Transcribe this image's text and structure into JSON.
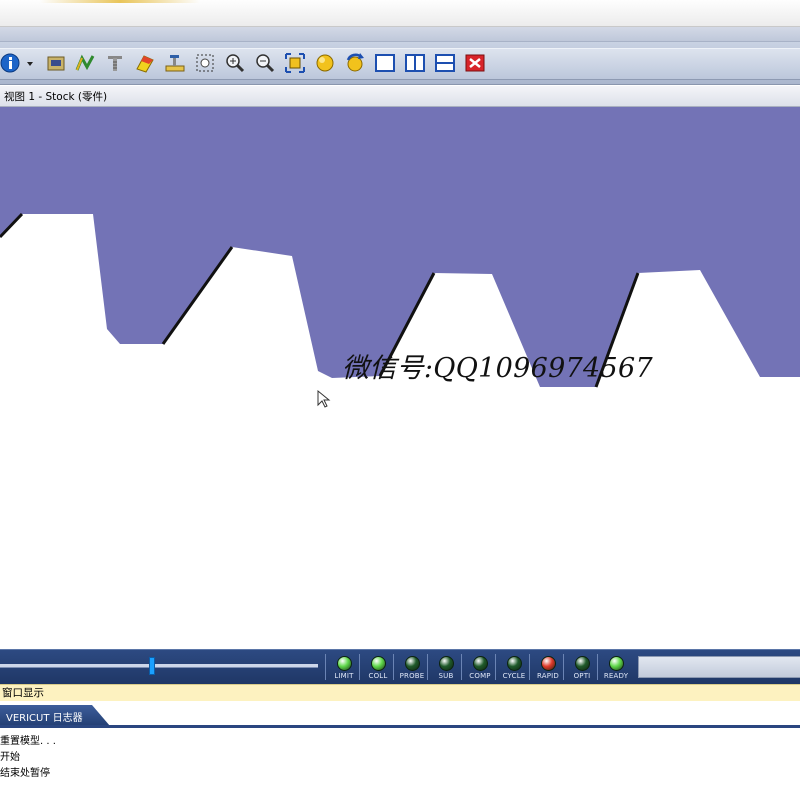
{
  "toolbar": {
    "icons": [
      "info-icon",
      "dropdown-arrow-icon",
      "model-icon",
      "toolpath-icon",
      "cut-icon",
      "color-icon",
      "machine-icon",
      "zoom-box-icon",
      "zoom-in-icon",
      "zoom-out-icon",
      "fit-icon",
      "shade-icon",
      "reverse-icon",
      "layout-single-icon",
      "layout-split-vertical-icon",
      "layout-split-horizontal-icon",
      "close-view-icon"
    ]
  },
  "view": {
    "title": "视图 1 - Stock (零件)",
    "background_color": "#ffffff",
    "stock_color": "#7373b6",
    "watermark": "微信号:QQ1096974567"
  },
  "status": {
    "slider_position": 0.47,
    "leds": [
      {
        "label": "LIMIT",
        "color": "#5fd84a"
      },
      {
        "label": "COLL",
        "color": "#5fd84a"
      },
      {
        "label": "PROBE",
        "color": "#1f5a2a"
      },
      {
        "label": "SUB",
        "color": "#1f5a2a"
      },
      {
        "label": "COMP",
        "color": "#1f5a2a"
      },
      {
        "label": "CYCLE",
        "color": "#1f5a2a"
      },
      {
        "label": "RAPID",
        "color": "#e03a2a"
      },
      {
        "label": "OPTI",
        "color": "#1f5a2a"
      },
      {
        "label": "READY",
        "color": "#5fd84a"
      }
    ]
  },
  "info_bar": {
    "text": "窗口显示"
  },
  "log": {
    "tab_label": "VERICUT 日志器",
    "lines": [
      "重置模型. . .",
      "开始",
      "结束处暂停"
    ]
  }
}
